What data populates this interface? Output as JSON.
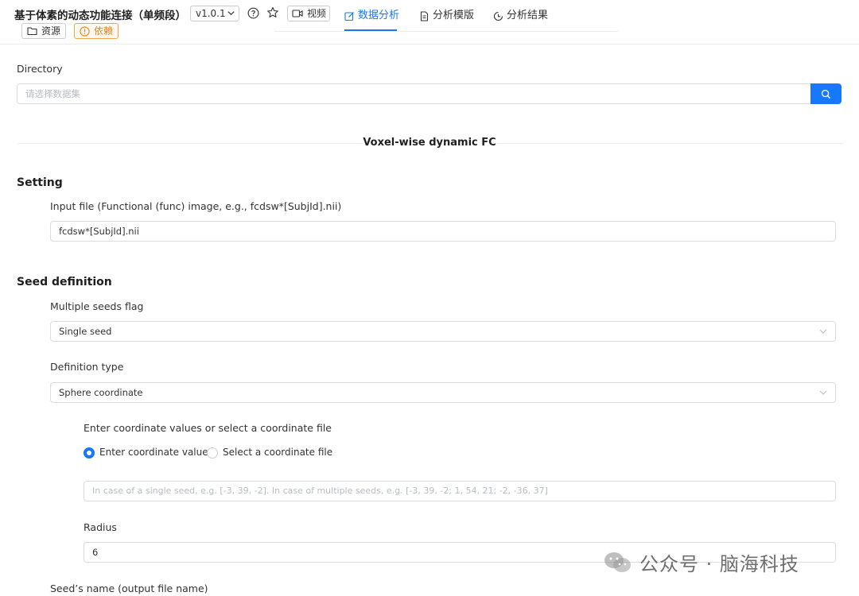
{
  "app": {
    "title": "基于体素的动态功能连接（单频段）",
    "version": "v1.0.1",
    "video_label": "视频",
    "resource_label": "资源",
    "dependency_label": "依赖"
  },
  "tabs": [
    {
      "label": "数据分析",
      "active": true
    },
    {
      "label": "分析模版",
      "active": false
    },
    {
      "label": "分析结果",
      "active": false
    }
  ],
  "directory": {
    "label": "Directory",
    "placeholder": "请选择数据集"
  },
  "section_divider": "Voxel-wise dynamic FC",
  "setting": {
    "title": "Setting",
    "input_file_label": "Input file (Functional (func) image, e.g., fcdsw*[SubjId].nii)",
    "input_file_value": "fcdsw*[SubjId].nii"
  },
  "seed": {
    "title": "Seed definition",
    "multiple_flag_label": "Multiple seeds flag",
    "multiple_flag_value": "Single seed",
    "definition_type_label": "Definition type",
    "definition_type_value": "Sphere coordinate",
    "coord_prompt": "Enter coordinate values or select a coordinate file",
    "radio_enter": "Enter coordinate values",
    "radio_select": "Select a coordinate file",
    "coord_placeholder": "In case of a single seed, e.g. [-3, 39, -2]. In case of multiple seeds, e.g. [-3, 39, -2; 1, 54, 21; -2, -36, 37]",
    "radius_label": "Radius",
    "radius_value": "6",
    "seed_name_label": "Seed’s name (output file name)"
  },
  "watermark": "公众号 · 脑海科技",
  "colors": {
    "accent": "#1677ff",
    "warning": "#e8851f"
  }
}
